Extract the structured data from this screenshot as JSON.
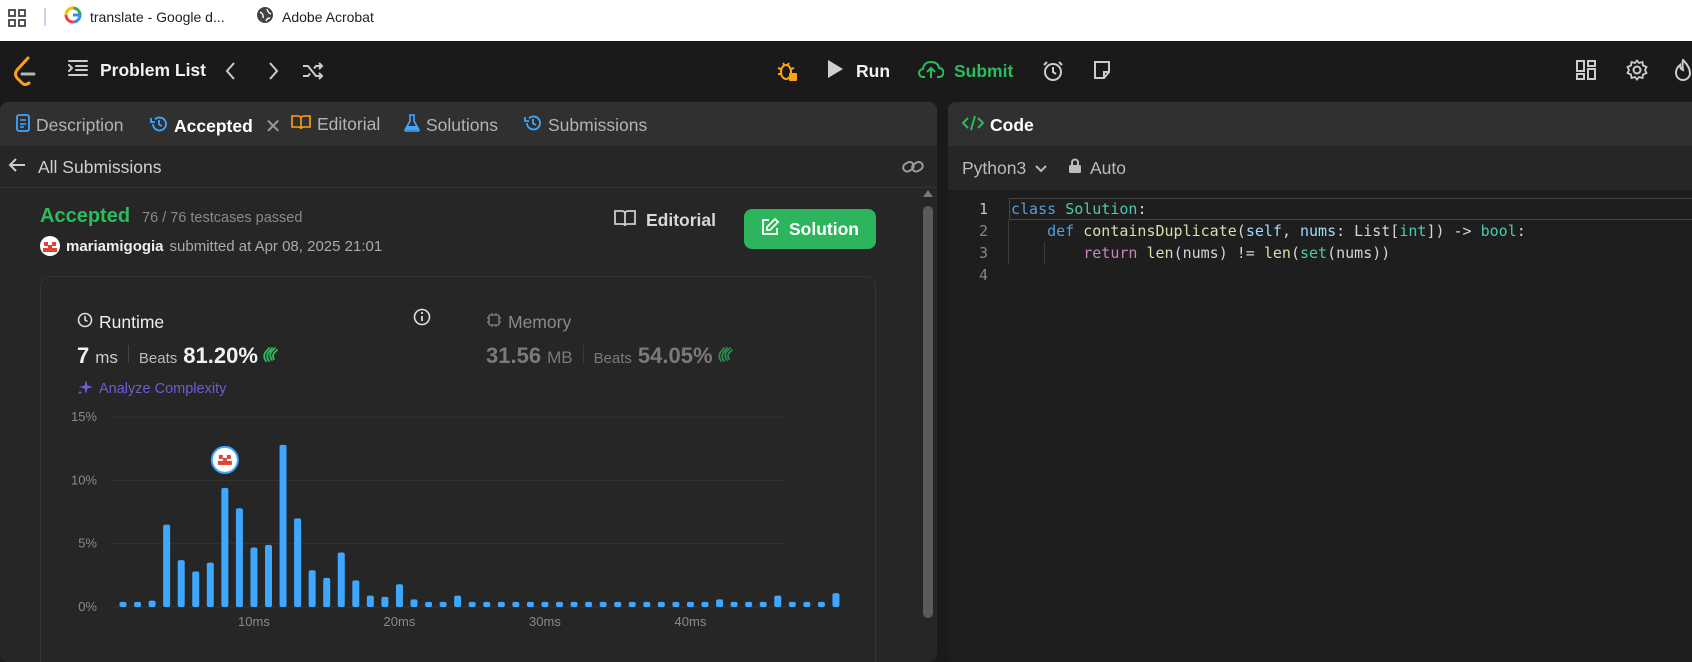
{
  "bookmarks": [
    {
      "label": "translate - Google d...",
      "icon": "google-icon"
    },
    {
      "label": "Adobe Acrobat",
      "icon": "globe-icon"
    }
  ],
  "nav": {
    "problem_list": "Problem List",
    "run": "Run",
    "submit": "Submit"
  },
  "left_tabs": [
    {
      "label": "Description",
      "icon": "description-icon"
    },
    {
      "label": "Accepted",
      "icon": "history-icon"
    },
    {
      "label": "Editorial",
      "icon": "book-icon"
    },
    {
      "label": "Solutions",
      "icon": "flask-icon"
    },
    {
      "label": "Submissions",
      "icon": "history-icon"
    }
  ],
  "all_submissions": "All Submissions",
  "result": {
    "status": "Accepted",
    "testcases": "76 / 76 testcases passed",
    "user": "mariamigogia",
    "submitted_at": "submitted at Apr 08, 2025 21:01",
    "editorial_btn": "Editorial",
    "solution_btn": "Solution"
  },
  "runtime": {
    "label": "Runtime",
    "value": "7",
    "unit": "ms",
    "beats_label": "Beats",
    "beats": "81.20%",
    "analyze": "Analyze Complexity"
  },
  "memory": {
    "label": "Memory",
    "value": "31.56",
    "unit": "MB",
    "beats_label": "Beats",
    "beats": "54.05%"
  },
  "colors": {
    "accepted": "#2cbb5d",
    "solution_btn": "#2db55d",
    "bar": "#3ea7ff",
    "analyze": "#6e5bd6",
    "keyword": "#569cd6"
  },
  "chart_data": {
    "type": "bar",
    "ylabel_ticks": [
      "15%",
      "10%",
      "5%",
      "0%"
    ],
    "xlabel_ticks": [
      "10ms",
      "20ms",
      "30ms",
      "40ms"
    ],
    "ylim": [
      0,
      15
    ],
    "x": [
      1,
      2,
      3,
      4,
      5,
      6,
      7,
      8,
      9,
      10,
      11,
      12,
      13,
      14,
      15,
      16,
      17,
      18,
      19,
      20,
      21,
      22,
      23,
      24,
      25,
      26,
      27,
      28,
      29,
      30,
      31,
      32,
      33,
      34,
      35,
      36,
      37,
      38,
      39,
      40,
      41,
      42,
      43,
      44,
      45,
      46,
      47,
      48,
      49,
      50
    ],
    "values": [
      0.4,
      0.4,
      0.5,
      6.5,
      3.7,
      2.8,
      3.5,
      9.4,
      7.8,
      4.7,
      4.9,
      12.8,
      7.0,
      2.9,
      2.3,
      4.3,
      2.1,
      0.9,
      0.8,
      1.8,
      0.6,
      0.4,
      0.4,
      0.9,
      0.4,
      0.4,
      0.4,
      0.4,
      0.4,
      0.4,
      0.4,
      0.4,
      0.4,
      0.4,
      0.4,
      0.4,
      0.4,
      0.4,
      0.4,
      0.4,
      0.4,
      0.6,
      0.4,
      0.4,
      0.4,
      0.9,
      0.4,
      0.4,
      0.4,
      1.1
    ],
    "user_bar_index": 7,
    "grid": true
  },
  "code_panel": {
    "title": "Code",
    "language": "Python3",
    "mode": "Auto",
    "lines": [
      {
        "n": "1",
        "text": "class Solution:"
      },
      {
        "n": "2",
        "text": "    def containsDuplicate(self, nums: List[int]) -> bool:"
      },
      {
        "n": "3",
        "text": "        return len(nums) != len(set(nums))"
      },
      {
        "n": "4",
        "text": ""
      }
    ]
  }
}
